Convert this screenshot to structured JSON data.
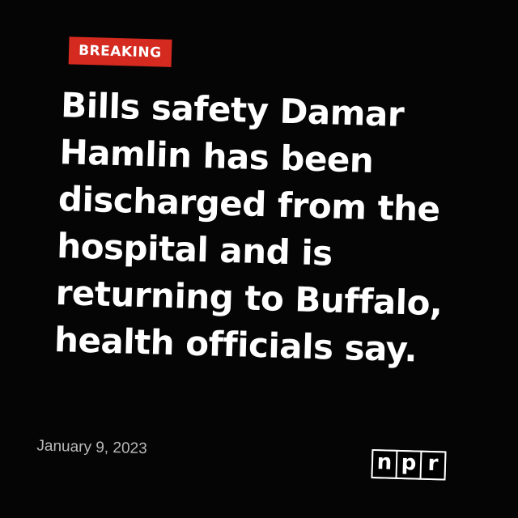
{
  "badge": {
    "label": "BREAKING",
    "color": "#d42a20"
  },
  "headline": {
    "text": "Bills safety Damar Hamlin has been discharged from the hospital and is returning to Buffalo, health officials say."
  },
  "footer": {
    "date": "January 9, 2023",
    "logo": {
      "letters": [
        "n",
        "p",
        "r"
      ],
      "name": "npr-logo"
    }
  },
  "colors": {
    "background": "#050505",
    "text": "#ffffff",
    "date_text": "#b9b9b9"
  }
}
